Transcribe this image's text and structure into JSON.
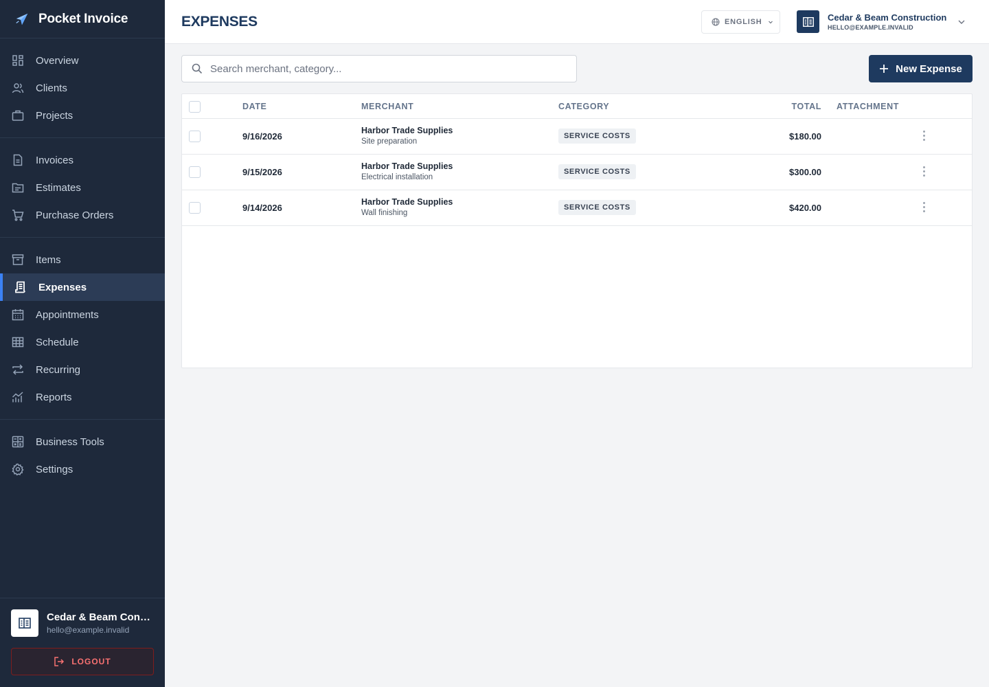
{
  "app": {
    "name": "Pocket Invoice"
  },
  "sidebar": {
    "groups": [
      [
        {
          "label": "Overview",
          "icon": "overview-icon"
        },
        {
          "label": "Clients",
          "icon": "clients-icon"
        },
        {
          "label": "Projects",
          "icon": "projects-icon"
        }
      ],
      [
        {
          "label": "Invoices",
          "icon": "invoices-icon"
        },
        {
          "label": "Estimates",
          "icon": "estimates-icon"
        },
        {
          "label": "Purchase Orders",
          "icon": "cart-icon"
        }
      ],
      [
        {
          "label": "Items",
          "icon": "items-icon"
        },
        {
          "label": "Expenses",
          "icon": "receipt-icon",
          "active": true
        },
        {
          "label": "Appointments",
          "icon": "calendar-icon"
        },
        {
          "label": "Schedule",
          "icon": "grid-icon"
        },
        {
          "label": "Recurring",
          "icon": "repeat-icon"
        },
        {
          "label": "Reports",
          "icon": "chart-icon"
        }
      ],
      [
        {
          "label": "Business Tools",
          "icon": "tools-icon"
        },
        {
          "label": "Settings",
          "icon": "gear-icon"
        }
      ]
    ],
    "account": {
      "name": "Cedar & Beam Const...",
      "email": "hello@example.invalid"
    },
    "logout_label": "LOGOUT"
  },
  "header": {
    "title": "EXPENSES",
    "language": "ENGLISH",
    "company": {
      "name": "Cedar & Beam Construction",
      "email": "HELLO@EXAMPLE.INVALID"
    }
  },
  "toolbar": {
    "search_placeholder": "Search merchant, category...",
    "new_button_label": "New Expense"
  },
  "table": {
    "columns": {
      "date": "DATE",
      "merchant": "MERCHANT",
      "category": "CATEGORY",
      "total": "TOTAL",
      "attachment": "ATTACHMENT"
    },
    "rows": [
      {
        "date": "9/16/2026",
        "merchant": "Harbor Trade Supplies",
        "description": "Site preparation",
        "category": "SERVICE COSTS",
        "total": "$180.00"
      },
      {
        "date": "9/15/2026",
        "merchant": "Harbor Trade Supplies",
        "description": "Electrical installation",
        "category": "SERVICE COSTS",
        "total": "$300.00"
      },
      {
        "date": "9/14/2026",
        "merchant": "Harbor Trade Supplies",
        "description": "Wall finishing",
        "category": "SERVICE COSTS",
        "total": "$420.00"
      }
    ]
  },
  "colors": {
    "sidebar_bg": "#1e293b",
    "accent": "#3b82f6",
    "primary": "#1e3a5f",
    "danger": "#f87171"
  }
}
